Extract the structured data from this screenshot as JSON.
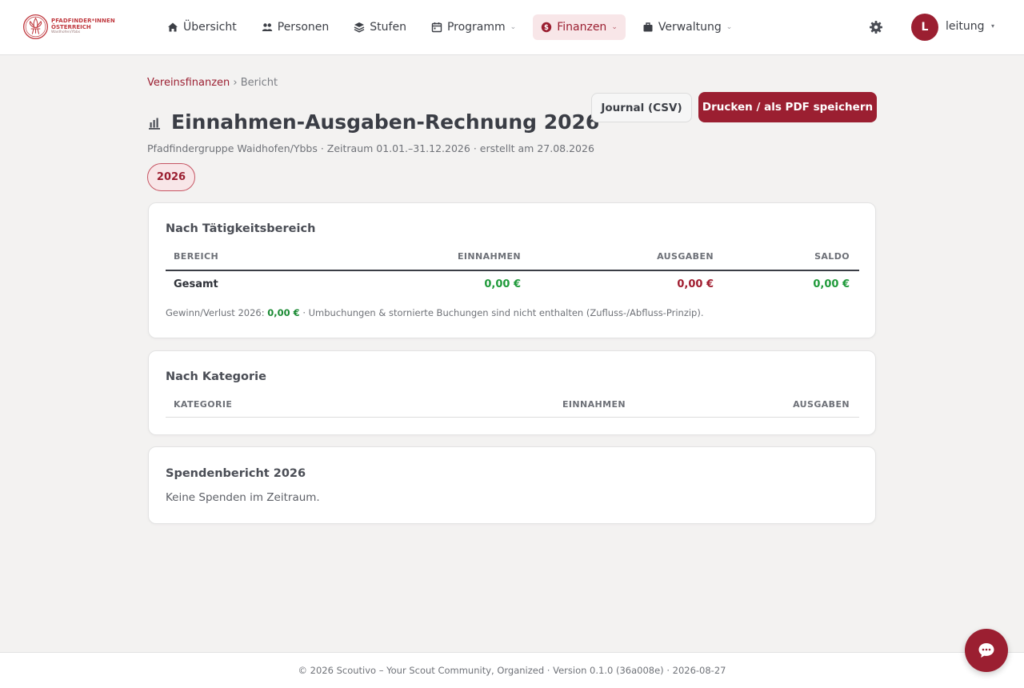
{
  "brand": {
    "line1": "PFADFINDER*INNEN",
    "line2": "ÖSTERREICH",
    "line3": "Waidhofen/Ybbs"
  },
  "nav": {
    "items": [
      {
        "label": "Übersicht",
        "icon": "home-icon"
      },
      {
        "label": "Personen",
        "icon": "users-icon"
      },
      {
        "label": "Stufen",
        "icon": "layers-icon"
      },
      {
        "label": "Programm",
        "icon": "calendar-icon",
        "has_dropdown": true
      },
      {
        "label": "Finanzen",
        "icon": "dollar-icon",
        "has_dropdown": true,
        "active": true
      },
      {
        "label": "Verwaltung",
        "icon": "briefcase-icon",
        "has_dropdown": true
      }
    ],
    "settings_icon": "gear-icon"
  },
  "user": {
    "initial": "L",
    "name": "leitung",
    "caret": "▾"
  },
  "breadcrumb": {
    "parent": "Vereinsfinanzen",
    "separator": "›",
    "current": "Bericht"
  },
  "page": {
    "title": "Einnahmen-Ausgaben-Rechnung 2026",
    "title_icon": "bar-chart-icon",
    "subtitle": "Pfadfindergruppe Waidhofen/Ybbs · Zeitraum 01.01.–31.12.2026 · erstellt am 27.08.2026"
  },
  "actions": {
    "journal_label": "Journal (CSV)",
    "print_label": "Drucken / als PDF speichern"
  },
  "year_filter": {
    "selected": "2026"
  },
  "by_area": {
    "title": "Nach Tätigkeitsbereich",
    "headers": [
      "BEREICH",
      "EINNAHMEN",
      "AUSGABEN",
      "SALDO"
    ],
    "row": {
      "label": "Gesamt",
      "income": "0,00 €",
      "expenses": "0,00 €",
      "balance": "0,00 €"
    },
    "note_prefix": "Gewinn/Verlust 2026:",
    "note_value": "0,00 €",
    "note_suffix": "· Umbuchungen & stornierte Buchungen sind nicht enthalten (Zufluss-/Abfluss-Prinzip)."
  },
  "by_category": {
    "title": "Nach Kategorie",
    "headers": [
      "KATEGORIE",
      "EINNAHMEN",
      "AUSGABEN"
    ]
  },
  "donations": {
    "title": "Spendenbericht 2026",
    "empty_text": "Keine Spenden im Zeitraum."
  },
  "footer": {
    "text": "© 2026 Scoutivo – Your Scout Community, Organized · Version 0.1.0 (36a008e) · 2026-08-27"
  },
  "colors": {
    "brand": "#9b1f31",
    "positive": "#1f9a3a",
    "negative": "#a01c2f",
    "background": "#f3f2f1"
  }
}
